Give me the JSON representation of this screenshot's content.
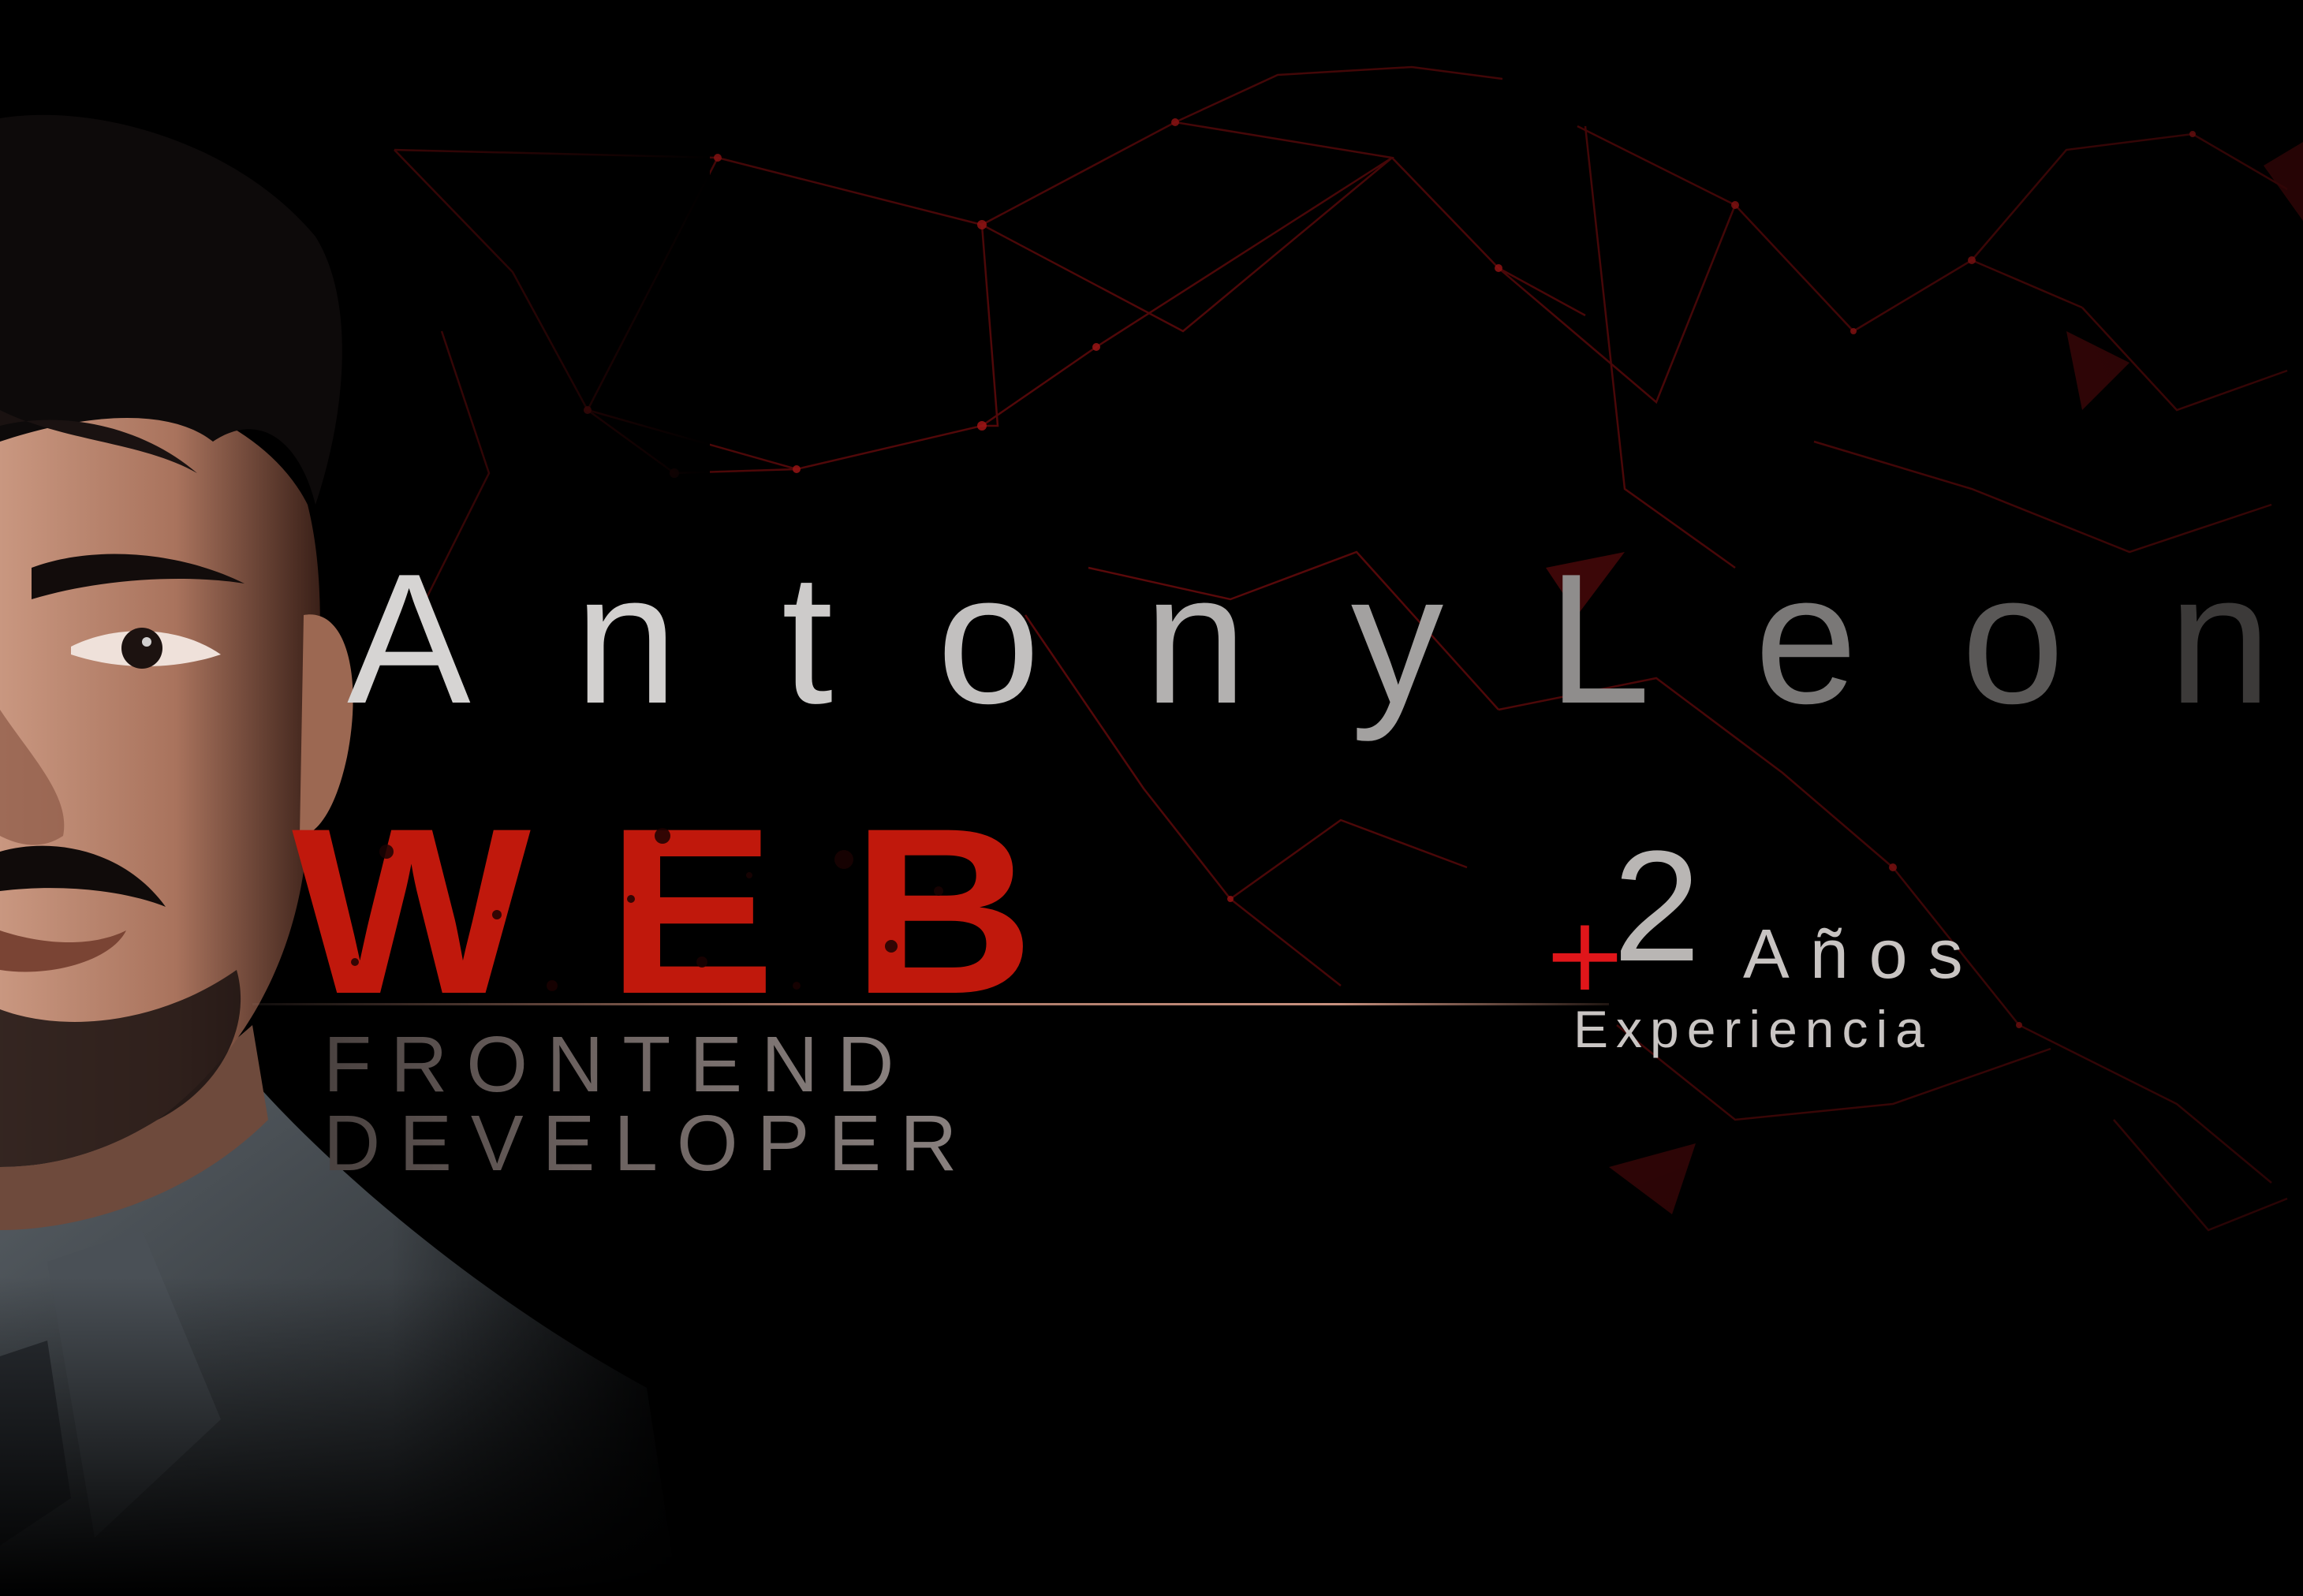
{
  "name": {
    "letters": [
      "A",
      "n",
      "t",
      "o",
      "n",
      "y",
      "L",
      "e",
      "o",
      "n"
    ],
    "colors": [
      "#d6d4d3",
      "#d2d0cf",
      "#cdcbca",
      "#c2c0bf",
      "#b3b1b0",
      "#a3a1a0",
      "#8f8d8c",
      "#7a7877",
      "#5a5857",
      "#3c3a39"
    ]
  },
  "title": {
    "main": "WEB",
    "line1": "FRONTEND",
    "line2": "DEVELOPER"
  },
  "experience": {
    "plus": "+",
    "number": "2",
    "unit": "Años",
    "label": "Experiencia"
  },
  "colors": {
    "background": "#000000",
    "accent_red": "#c0180c",
    "plus_red": "#e0161a",
    "network_red": "#8a0f10"
  }
}
